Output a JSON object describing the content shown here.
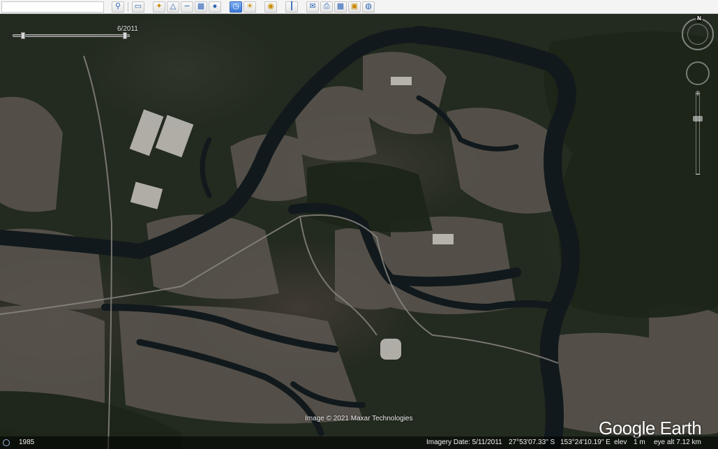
{
  "toolbar": {
    "search_placeholder": "",
    "icons": [
      "add-icon",
      "search-icon",
      "sidebar-icon",
      "placemark-icon",
      "polygon-icon",
      "path-icon",
      "image-overlay-icon",
      "tour-icon",
      "historical-imagery-icon",
      "sunlight-icon",
      "planets-icon",
      "ruler-icon",
      "email-icon",
      "print-icon",
      "save-image-icon",
      "view-in-maps-icon",
      "web-icon"
    ]
  },
  "time_slider": {
    "label": "6/2011"
  },
  "nav": {
    "north_label": "N",
    "zoom_plus": "+",
    "zoom_minus": "−"
  },
  "map": {
    "credit": "Image © 2021 Maxar Technologies",
    "logo": "Google Earth"
  },
  "status_bar": {
    "year": "1985",
    "imagery_date": "Imagery Date: 5/11/2011",
    "latitude": "27°53'07.33\" S",
    "longitude": "153°24'10.19\" E",
    "elev_label": "elev",
    "elev_value": "1 m",
    "eye_alt": "eye alt  7.12 km"
  },
  "colors": {
    "water": "#121a1d",
    "urban": "#9a8f86",
    "forest": "#1f2a1b",
    "toolbar": "#f4f4f4",
    "active": "#3c78d6"
  }
}
